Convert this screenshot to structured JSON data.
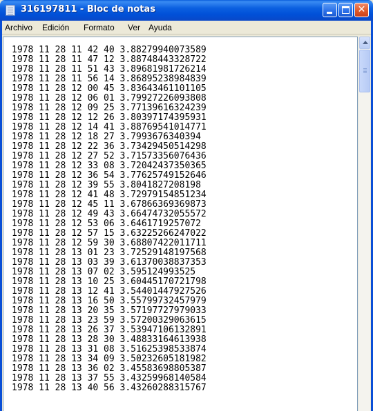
{
  "window": {
    "title": "316197811 - Bloc de notas",
    "icon": "notepad-icon",
    "controls": {
      "minimize": "minimize-icon",
      "maximize": "maximize-icon",
      "close": "close-icon"
    }
  },
  "menubar": {
    "items": [
      {
        "label": "Archivo"
      },
      {
        "label": "Edición"
      },
      {
        "label": "Formato"
      },
      {
        "label": "Ver"
      },
      {
        "label": "Ayuda"
      }
    ]
  },
  "editor": {
    "lines": [
      "1978 11 28 11 42 40 3.88279940073589",
      "1978 11 28 11 47 12 3.88748443328722",
      "1978 11 28 11 51 43 3.89681981726214",
      "1978 11 28 11 56 14 3.86895238984839",
      "1978 11 28 12 00 45 3.83643461101105",
      "1978 11 28 12 06 01 3.79927226093808",
      "1978 11 28 12 09 25 3.77139616324239",
      "1978 11 28 12 12 26 3.80397174395931",
      "1978 11 28 12 14 41 3.88769541014771",
      "1978 11 28 12 18 27 3.7993676340394",
      "1978 11 28 12 22 36 3.73429450514298",
      "1978 11 28 12 27 52 3.71573356076436",
      "1978 11 28 12 33 08 3.72042437350365",
      "1978 11 28 12 36 54 3.77625749152646",
      "1978 11 28 12 39 55 3.8041827208198",
      "1978 11 28 12 41 48 3.72979154851234",
      "1978 11 28 12 45 11 3.67866369369873",
      "1978 11 28 12 49 43 3.66474732055572",
      "1978 11 28 12 53 06 3.6461719257072",
      "1978 11 28 12 57 15 3.63225266247022",
      "1978 11 28 12 59 30 3.68807422011711",
      "1978 11 28 13 01 23 3.72529148197568",
      "1978 11 28 13 03 39 3.61370038837353",
      "1978 11 28 13 07 02 3.595124993525",
      "1978 11 28 13 10 25 3.60445170721798",
      "1978 11 28 13 12 41 3.54401447927526",
      "1978 11 28 13 16 50 3.55799732457979",
      "1978 11 28 13 20 35 3.57197727979033",
      "1978 11 28 13 23 59 3.57200329063615",
      "1978 11 28 13 26 37 3.53947106132891",
      "1978 11 28 13 28 30 3.48833164613938",
      "1978 11 28 13 31 08 3.51625398533874",
      "1978 11 28 13 34 09 3.50232605181982",
      "1978 11 28 13 36 02 3.45583698805387",
      "1978 11 28 13 37 55 3.43259968140584",
      "1978 11 28 13 40 56 3.43260288315767"
    ]
  },
  "scrollbar": {
    "up_arrow": "scroll-up-icon",
    "position": 0.0
  },
  "colors": {
    "titlebar": "#0b5fe0",
    "close_button": "#e05a2a",
    "chrome": "#ece9d8"
  }
}
